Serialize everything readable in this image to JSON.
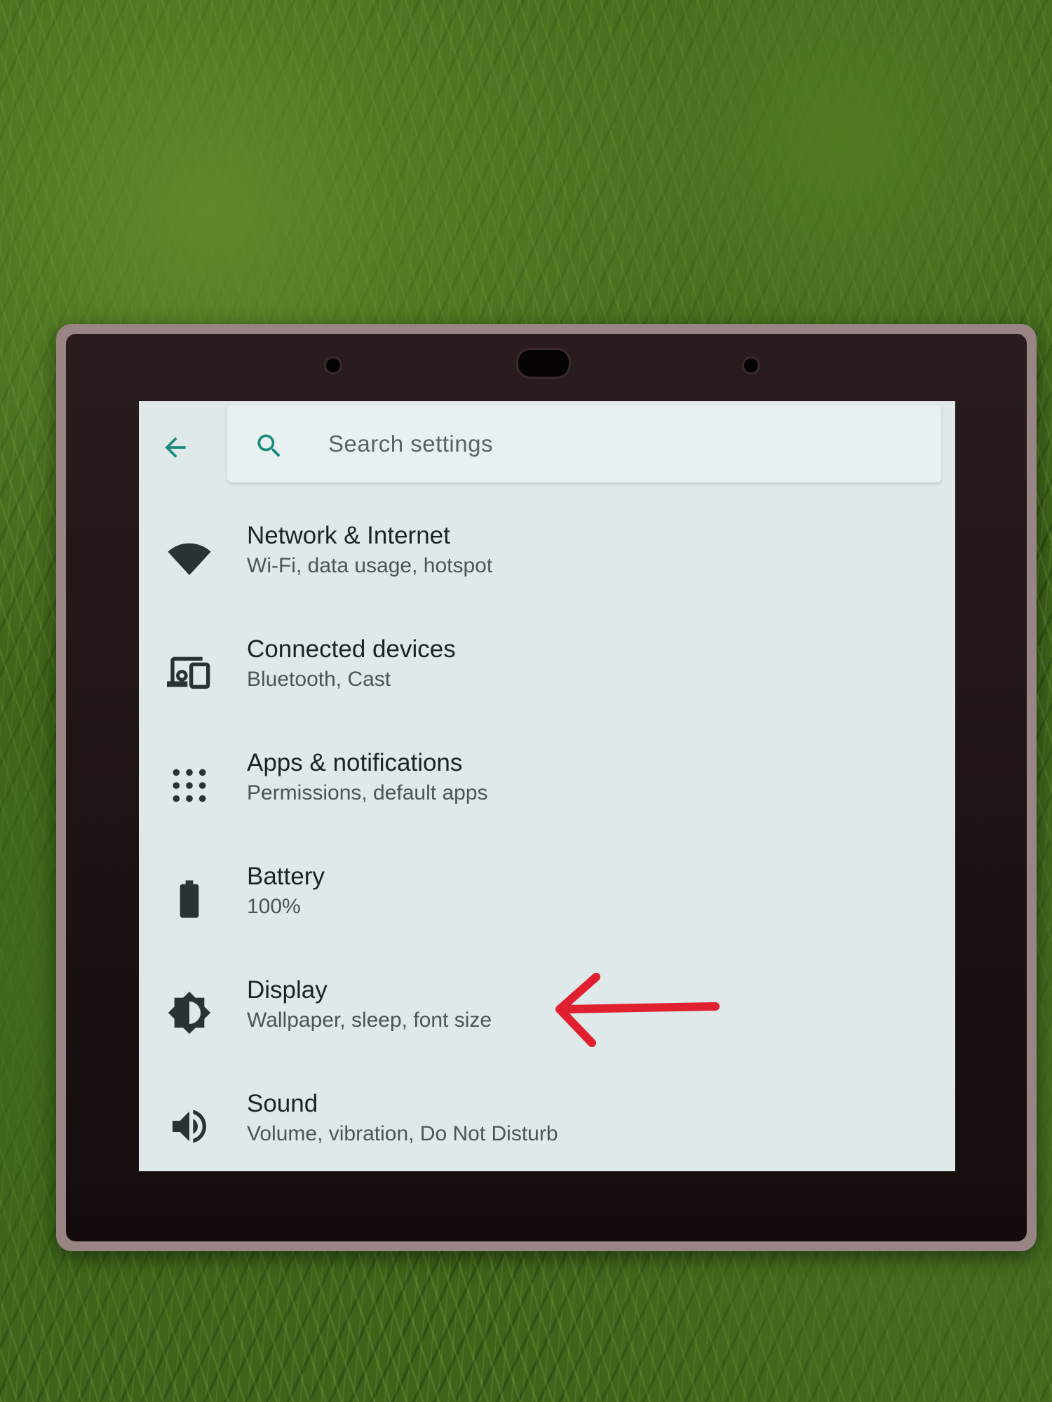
{
  "search": {
    "placeholder": "Search settings"
  },
  "icons": {
    "back": "arrow-back-icon",
    "search": "search-icon"
  },
  "colors": {
    "accent": "#1a8a7a",
    "annotation_arrow": "#e0202e"
  },
  "settings": [
    {
      "title": "Network & Internet",
      "subtitle": "Wi-Fi, data usage, hotspot",
      "icon": "wifi-icon"
    },
    {
      "title": "Connected devices",
      "subtitle": "Bluetooth, Cast",
      "icon": "devices-icon"
    },
    {
      "title": "Apps & notifications",
      "subtitle": "Permissions, default apps",
      "icon": "apps-grid-icon"
    },
    {
      "title": "Battery",
      "subtitle": "100%",
      "icon": "battery-icon"
    },
    {
      "title": "Display",
      "subtitle": "Wallpaper, sleep, font size",
      "icon": "brightness-icon"
    },
    {
      "title": "Sound",
      "subtitle": "Volume, vibration, Do Not Disturb",
      "icon": "volume-icon"
    }
  ]
}
